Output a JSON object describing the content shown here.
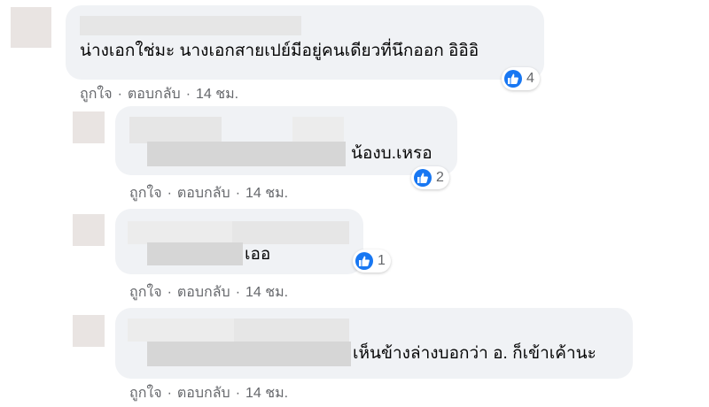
{
  "comments": [
    {
      "text": "น่างเอกใช่มะ นางเอกสายเปย์มีอยู่คนเดียวที่นึกออก อิอิอิ",
      "likes": "4",
      "actions": {
        "like": "ถูกใจ",
        "reply": "ตอบกลับ",
        "time": "14 ชม."
      }
    },
    {
      "text": "น้องบ.เหรอ",
      "likes": "2",
      "actions": {
        "like": "ถูกใจ",
        "reply": "ตอบกลับ",
        "time": "14 ชม."
      }
    },
    {
      "text": "เออ",
      "likes": "1",
      "actions": {
        "like": "ถูกใจ",
        "reply": "ตอบกลับ",
        "time": "14 ชม."
      }
    },
    {
      "text": "เห็นข้างล่างบอกว่า อ. ก็เข้าเค้านะ",
      "actions": {
        "like": "ถูกใจ",
        "reply": "ตอบกลับ",
        "time": "14 ชม."
      }
    }
  ],
  "separator": "·",
  "colors": {
    "like_blue": "#1877f2",
    "bubble": "#f0f2f5",
    "meta_text": "#65676b"
  },
  "icons": {
    "reaction": "thumbs-up-icon"
  }
}
